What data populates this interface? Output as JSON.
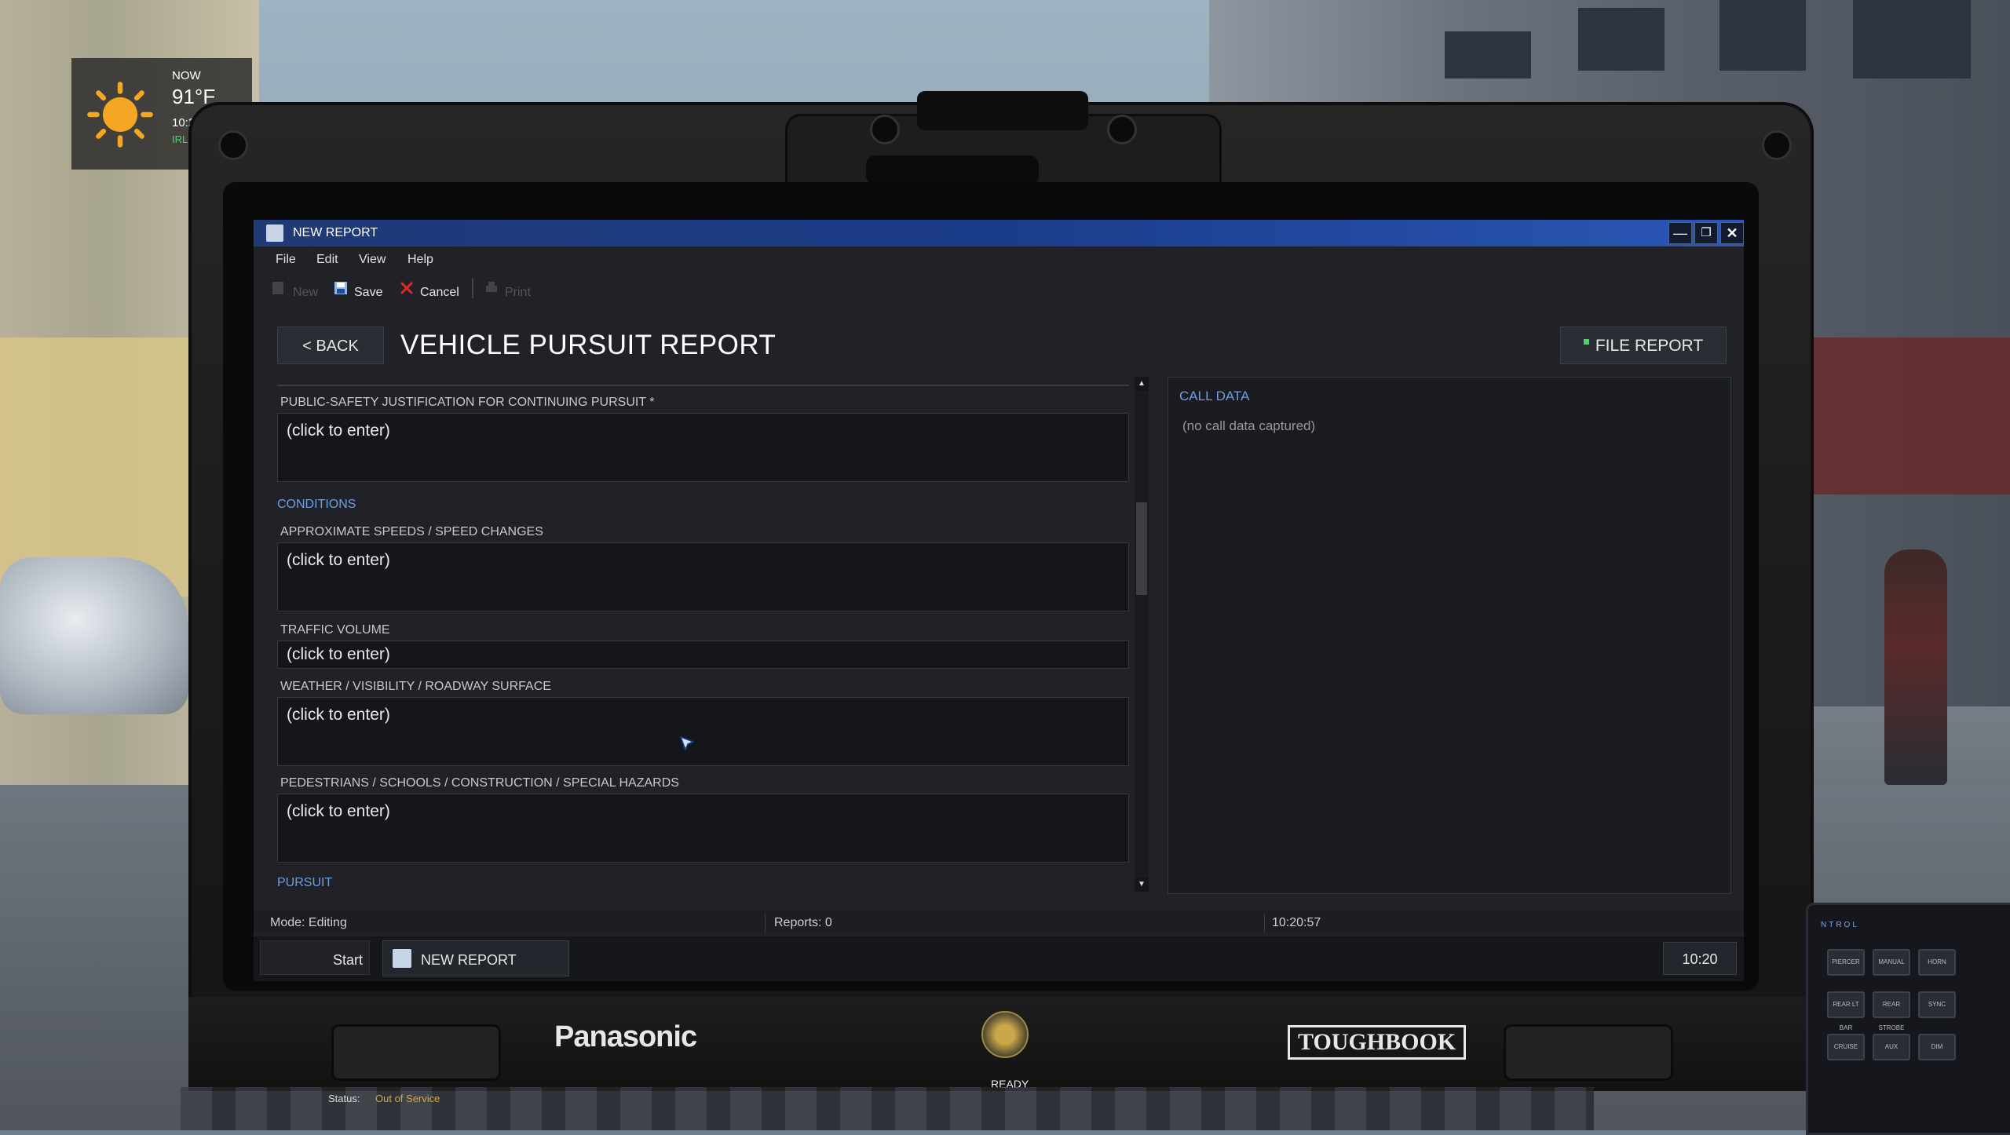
{
  "weather": {
    "now_label": "NOW",
    "temperature": "91°F",
    "time": "10:20 AM",
    "source": "IRL WEATHER"
  },
  "window": {
    "title": "NEW REPORT"
  },
  "menu": [
    "File",
    "Edit",
    "View",
    "Help"
  ],
  "toolbar": {
    "new_label": "New",
    "save_label": "Save",
    "cancel_label": "Cancel",
    "print_label": "Print"
  },
  "header": {
    "back_label": "< BACK",
    "title": "VEHICLE PURSUIT REPORT",
    "file_report_label": "FILE REPORT"
  },
  "form": {
    "fields": [
      {
        "label": "PUBLIC-SAFETY JUSTIFICATION FOR CONTINUING PURSUIT *",
        "value": "(click to enter)"
      },
      {
        "label": "APPROXIMATE SPEEDS / SPEED CHANGES",
        "value": "(click to enter)"
      },
      {
        "label": "TRAFFIC VOLUME",
        "value": "(click to enter)"
      },
      {
        "label": "WEATHER / VISIBILITY / ROADWAY SURFACE",
        "value": "(click to enter)"
      },
      {
        "label": "PEDESTRIANS / SCHOOLS / CONSTRUCTION / SPECIAL HAZARDS",
        "value": "(click to enter)"
      }
    ],
    "sections": {
      "conditions": "CONDITIONS",
      "pursuit": "PURSUIT"
    }
  },
  "call_data": {
    "heading": "CALL DATA",
    "value": "(no call data captured)"
  },
  "statusbar": {
    "mode": "Mode: Editing",
    "reports": "Reports: 0",
    "time": "10:20:57"
  },
  "taskbar": {
    "start_label": "Start",
    "task_label": "NEW REPORT",
    "clock": "10:20"
  },
  "device": {
    "brand_left": "Panasonic",
    "brand_right": "TOUGHBOOK",
    "ready_label": "READY",
    "status_label": "Status:",
    "status_value": "Out of Service"
  },
  "siren_panel": {
    "title": "NTROL",
    "buttons": [
      "PIERCER",
      "MANUAL",
      "HORN",
      "REAR LT BAR",
      "REAR STROBE",
      "SYNC",
      "CRUISE",
      "AUX",
      "DIM"
    ]
  },
  "colors": {
    "titlebar": "#1b3c8a",
    "accent_blue": "#6f9ee0",
    "file_indicator": "#4fd16a",
    "weather_source": "#55d16a"
  }
}
